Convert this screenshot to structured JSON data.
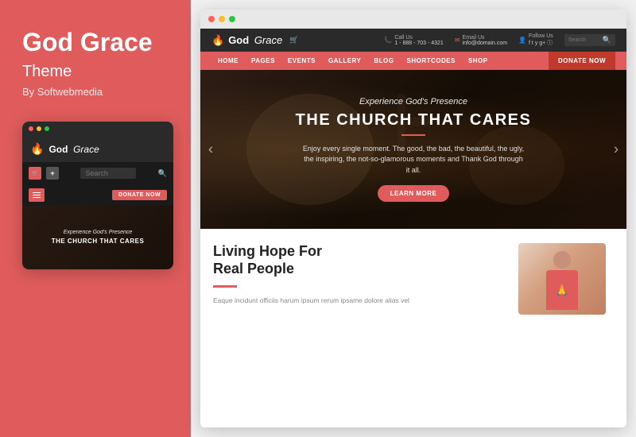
{
  "left": {
    "title": "God Grace",
    "subtitle": "Theme",
    "author": "By Softwebmedia"
  },
  "mobile": {
    "logo_flame": "🔥",
    "logo_god": "God",
    "logo_grace": "Grace",
    "search_placeholder": "Search",
    "donate_label": "DONATE NOW",
    "hero_subtitle": "Experience God's Presence",
    "hero_title": "THE CHURCH THAT CARES"
  },
  "browser": {
    "header": {
      "logo_flame": "🔥",
      "logo_god": "God",
      "logo_grace": "Grace",
      "call_label": "Call Us",
      "call_number": "1 - 888 - 703 - 4321",
      "email_label": "Email Us",
      "email_value": "info@domain.com",
      "follow_label": "Follow Us",
      "search_placeholder": "Search"
    },
    "nav": {
      "items": [
        "HOME",
        "PAGES",
        "EVENTS",
        "GALLERY",
        "BLOG",
        "SHORTCODES",
        "SHOP"
      ],
      "donate_label": "DONATE NOW"
    },
    "hero": {
      "subtitle": "Experience God's Presence",
      "title": "THE CHURCH THAT CARES",
      "description": "Enjoy every single moment. The good, the bad, the beautiful, the ugly, the inspiring, the not-so-glamorous moments and Thank God through it all.",
      "button_label": "LEARN MORE"
    },
    "content": {
      "section_title_line1": "Living Hope For",
      "section_title_line2": "Real People",
      "section_desc": "Eaque incidunt officiis harum ipsum rerum ipsame dolore alias vel"
    }
  },
  "dots": {
    "colors": [
      "#ff5f57",
      "#febc2e",
      "#28c840"
    ]
  }
}
